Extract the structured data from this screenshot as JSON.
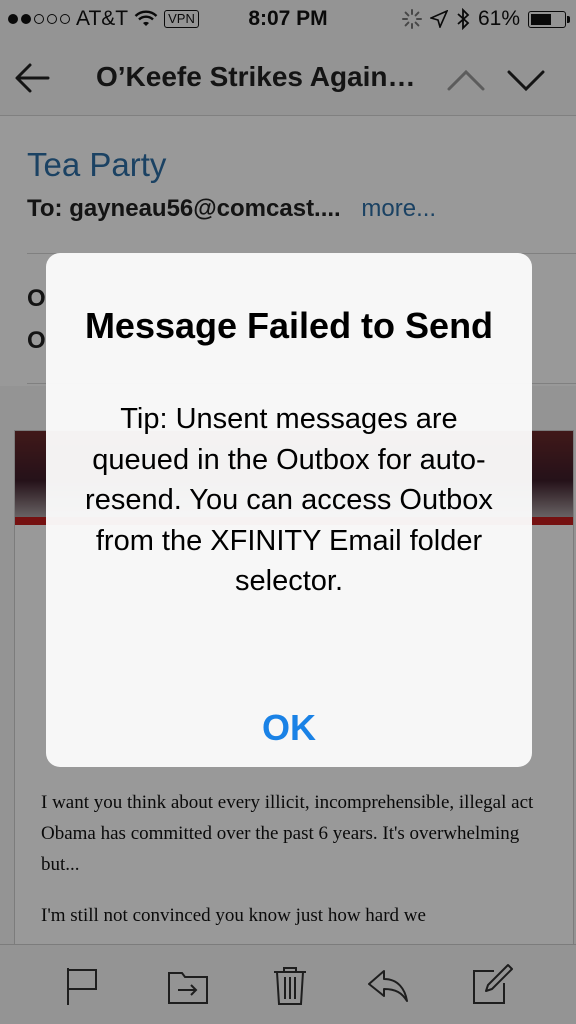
{
  "status_bar": {
    "carrier": "AT&T",
    "vpn": "VPN",
    "time": "8:07 PM",
    "battery": "61%"
  },
  "nav": {
    "title": "O’Keefe Strikes Again…"
  },
  "email": {
    "subject": "Tea Party",
    "to_label": "To:",
    "to_address": "gayneau56@comcast....",
    "more": "more...",
    "meta_line1": "O",
    "meta_line2": "O",
    "paragraph1": "I want you think about every illicit, incomprehensible, illegal act Obama has committed over the past 6 years. It's overwhelming but...",
    "paragraph2": "I'm still not convinced you know just how hard we"
  },
  "alert": {
    "title": "Message Failed to Send",
    "message": "Tip: Unsent messages are queued in the Outbox for auto-resend. You can access Outbox from the XFINITY Email folder selector.",
    "ok": "OK"
  },
  "colors": {
    "link": "#2d6ea6",
    "alert_button": "#1a82e6"
  },
  "icons": [
    "back-arrow-icon",
    "chevron-up-icon",
    "chevron-down-icon",
    "flag-icon",
    "move-folder-icon",
    "trash-icon",
    "reply-icon",
    "compose-icon"
  ]
}
